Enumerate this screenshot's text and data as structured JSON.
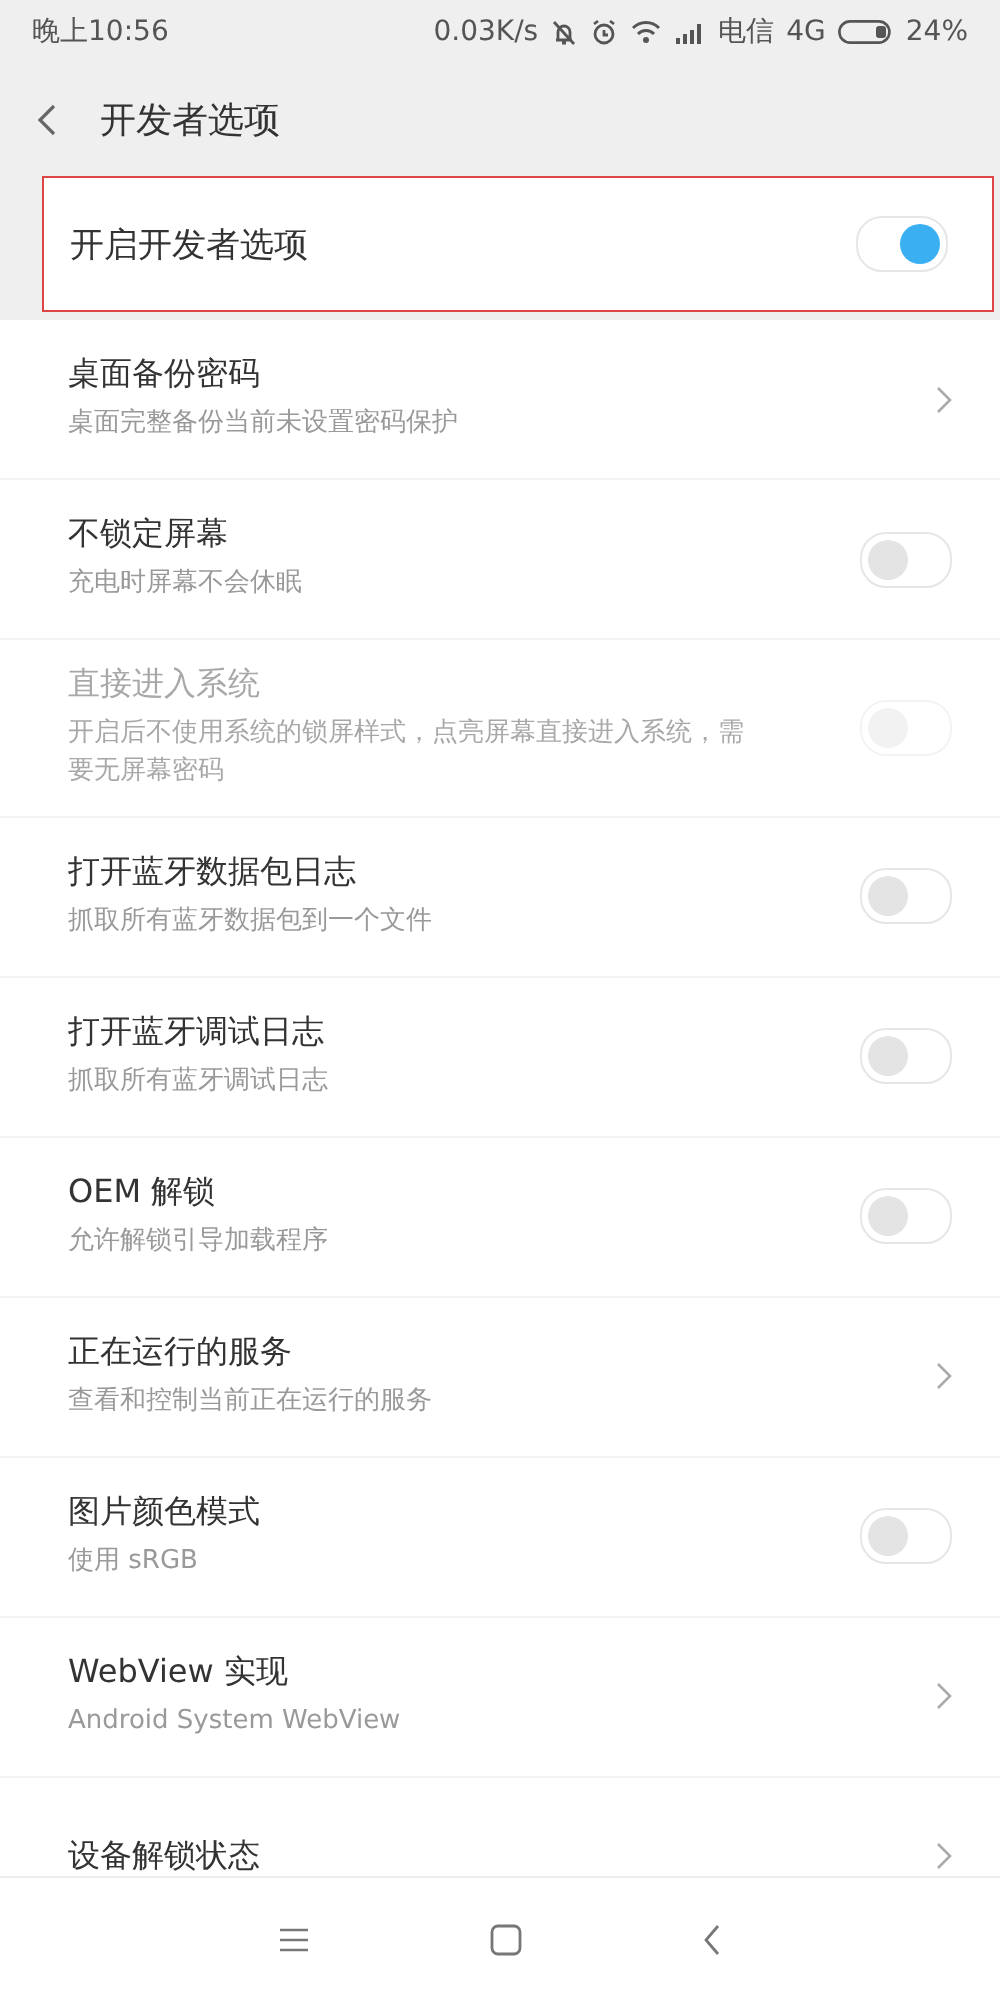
{
  "status_bar": {
    "time": "晚上10:56",
    "speed": "0.03K/s",
    "carrier": "电信",
    "network": "4G",
    "battery": "24%"
  },
  "header": {
    "title": "开发者选项"
  },
  "master": {
    "label": "开启开发者选项",
    "on": true,
    "highlighted": true
  },
  "rows": [
    {
      "kind": "link",
      "title": "桌面备份密码",
      "subtitle": "桌面完整备份当前未设置密码保护",
      "disabled": false
    },
    {
      "kind": "toggle",
      "title": "不锁定屏幕",
      "subtitle": "充电时屏幕不会休眠",
      "on": false,
      "disabled": false
    },
    {
      "kind": "toggle",
      "title": "直接进入系统",
      "subtitle": "开启后不使用系统的锁屏样式，点亮屏幕直接进入系统，需要无屏幕密码",
      "on": false,
      "disabled": true
    },
    {
      "kind": "toggle",
      "title": "打开蓝牙数据包日志",
      "subtitle": "抓取所有蓝牙数据包到一个文件",
      "on": false,
      "disabled": false
    },
    {
      "kind": "toggle",
      "title": "打开蓝牙调试日志",
      "subtitle": "抓取所有蓝牙调试日志",
      "on": false,
      "disabled": false
    },
    {
      "kind": "toggle",
      "title": "OEM 解锁",
      "subtitle": "允许解锁引导加载程序",
      "on": false,
      "disabled": false
    },
    {
      "kind": "link",
      "title": "正在运行的服务",
      "subtitle": "查看和控制当前正在运行的服务",
      "disabled": false
    },
    {
      "kind": "toggle",
      "title": "图片颜色模式",
      "subtitle": "使用 sRGB",
      "on": false,
      "disabled": false
    },
    {
      "kind": "link",
      "title": "WebView 实现",
      "subtitle": "Android System WebView",
      "disabled": false
    },
    {
      "kind": "link",
      "title": "设备解锁状态",
      "disabled": false
    }
  ]
}
